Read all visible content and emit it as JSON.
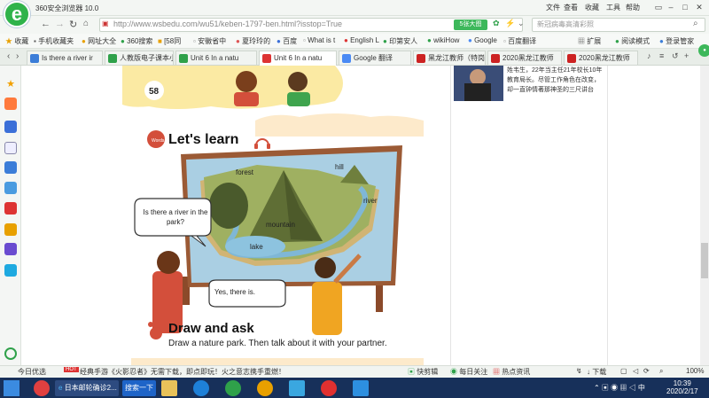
{
  "app": {
    "title": "360安全浏览器 10.0",
    "logo_letter": "e"
  },
  "menu": [
    "文件",
    "查看",
    "收藏",
    "工具",
    "帮助"
  ],
  "address": {
    "url": "http://www.wsbedu.com/wu51/keben-1797-ben.html?isstop=True",
    "zoom_badge": "5张大图",
    "search_placeholder": "新冠病毒高清彩照"
  },
  "bookmarks": [
    "收藏",
    "手机收藏夹",
    "网址大全",
    "360搜索",
    "[58同",
    "安徽省中",
    "夏玲玲的",
    "百度",
    "What is t",
    "English L",
    "印第安人",
    "wikiHow",
    "Google",
    "百度翻译",
    "扩展",
    "阅读模式",
    "登录管家"
  ],
  "tabs": [
    {
      "label": "Is there a river ir",
      "icon_color": "#3b7dd8"
    },
    {
      "label": "人教版电子课本小",
      "icon_color": "#2fa14a"
    },
    {
      "label": "Unit 6 In a natu",
      "icon_color": "#2fa14a"
    },
    {
      "label": "Unit 6  In a natu",
      "icon_color": "#d33"
    },
    {
      "label": "Google 翻译",
      "icon_color": "#4a8af4"
    },
    {
      "label": "黑龙江教师（特岗",
      "icon_color": "#c22"
    },
    {
      "label": "2020黑龙江教师",
      "icon_color": "#c22"
    },
    {
      "label": "2020黑龙江教师",
      "icon_color": "#c22"
    }
  ],
  "textbook": {
    "page_number": "58",
    "section1_title": "Let's learn",
    "labels": {
      "forest": "forest",
      "hill": "hill",
      "river": "river",
      "mountain": "mountain",
      "lake": "lake"
    },
    "question": "Is there a river in the park?",
    "answer": "Yes, there is.",
    "section2_title": "Draw and ask",
    "section2_text": "Draw a nature park. Then talk about it with your partner."
  },
  "ad": {
    "line1": "姓韦生，22年当主任21年校长10年",
    "line2": "教育局长。尽管工作角色在改变，",
    "line3": "却一直钟情著那神圣的三尺讲台"
  },
  "status": {
    "left": "今日优选",
    "news": "经典手游《火影忍者》无需下载，即点即玩！火之意志携手重燃！",
    "quick": "快剪辑",
    "daily": "每日关注",
    "hot": "热点资讯",
    "download": "下载",
    "zoom": "100%"
  },
  "taskbar": {
    "window1": "日本邮轮确诊2...",
    "search": "搜索一下",
    "time": "10:39",
    "date": "2020/2/17"
  }
}
